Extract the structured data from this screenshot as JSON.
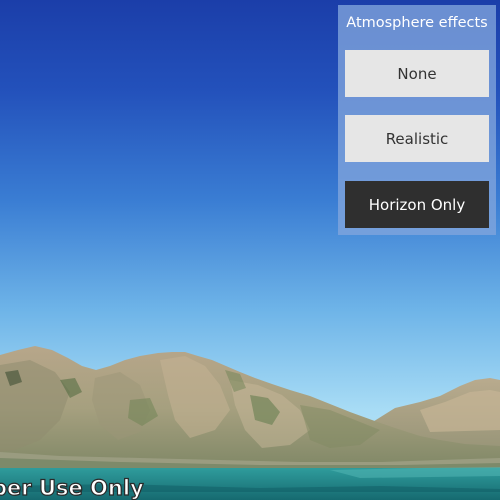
{
  "panel": {
    "title": "Atmosphere effects",
    "options": [
      {
        "label": "None",
        "selected": false
      },
      {
        "label": "Realistic",
        "selected": false
      },
      {
        "label": "Horizon Only",
        "selected": true
      }
    ]
  },
  "map": {
    "watermark": "Developer Use Only",
    "watermark_visible": "per Use Only"
  },
  "colors": {
    "sky_top": "#1a3fae",
    "sky_horizon": "#a9dcf5",
    "water": "#1f8a8a",
    "panel_background": "#82a5dc",
    "button_light": "#e6e6e6",
    "button_selected": "#2f2f2f"
  }
}
